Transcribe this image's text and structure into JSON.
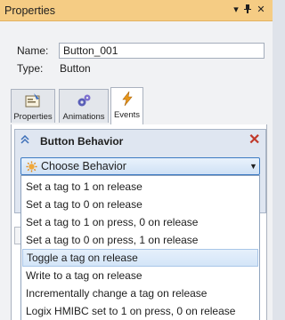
{
  "panel": {
    "title": "Properties",
    "pin_glyph": "▾ ↕",
    "close_glyph": "✕"
  },
  "fields": {
    "name_label": "Name:",
    "name_value": "Button_001",
    "type_label": "Type:",
    "type_value": "Button"
  },
  "tabs": [
    {
      "label": "Properties",
      "icon": "properties-icon"
    },
    {
      "label": "Animations",
      "icon": "animations-icon"
    },
    {
      "label": "Events",
      "icon": "lightning-icon",
      "active": true
    }
  ],
  "behavior": {
    "title": "Button Behavior",
    "close_glyph": "✕",
    "selected_label": "Choose Behavior",
    "options": [
      "Set a tag to 1 on release",
      "Set a tag to 0 on release",
      "Set a tag to 1 on press, 0 on release",
      "Set a tag to 0 on press, 1 on release",
      "Toggle a tag on release",
      "Write to a tag on release",
      "Incrementally change a tag on release",
      "Logix HMIBC set to 1 on press, 0 on release"
    ],
    "highlighted_index": 4
  },
  "colors": {
    "title_bar": "#f5cc84",
    "accent": "#3d7bc3",
    "close_red": "#c0392b"
  }
}
